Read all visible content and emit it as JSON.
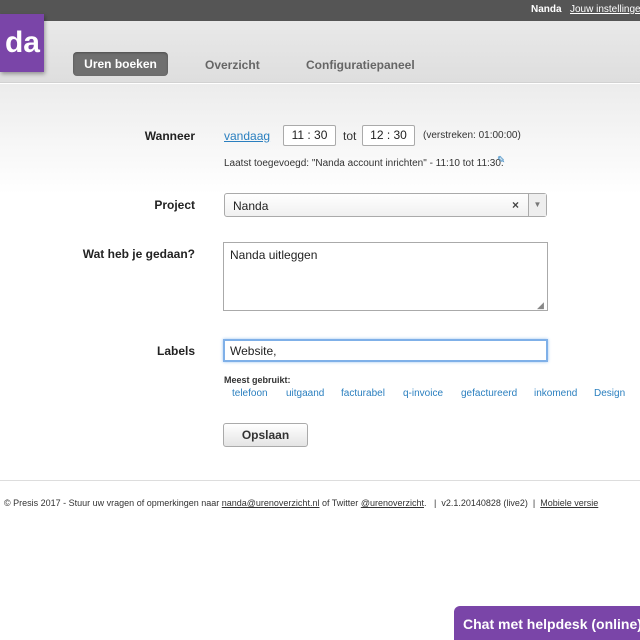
{
  "topbar": {
    "user": "Nanda",
    "settings": "Jouw instellingen"
  },
  "header": {
    "logo": "da",
    "nav": [
      "Uren boeken",
      "Overzicht",
      "Configuratiepaneel"
    ]
  },
  "form": {
    "when_label": "Wanneer",
    "today_link": "vandaag",
    "start_time": "11 : 30",
    "to": "tot",
    "end_time": "12 : 30",
    "elapsed": "(verstreken: 01:00:00)",
    "last_added": "Laatst toegevoegd: \"Nanda account inrichten\" - 11:10 tot 11:30.",
    "project_label": "Project",
    "project_value": "Nanda",
    "done_label": "Wat heb je gedaan?",
    "done_value": "Nanda uitleggen",
    "labels_label": "Labels",
    "labels_value": "Website,",
    "most_used_label": "Meest gebruikt:",
    "tags": [
      "telefoon",
      "uitgaand",
      "facturabel",
      "q-invoice",
      "gefactureerd",
      "inkomend",
      "Design"
    ],
    "save_button": "Opslaan"
  },
  "footer": {
    "text1": "© Presis 2017 - Stuur uw vragen of opmerkingen naar ",
    "email": "nanda@urenoverzicht.nl",
    "text2": " of Twitter ",
    "twitter": "@urenoverzicht",
    "text3": ".   |  v2.1.20140828 (live2)  |  ",
    "mobile": "Mobiele versie"
  },
  "chat": {
    "label": "Chat met helpdesk (online)"
  },
  "colors": {
    "brand": "#7a45a8",
    "link": "#2a7fbf",
    "topbar": "#555555"
  }
}
